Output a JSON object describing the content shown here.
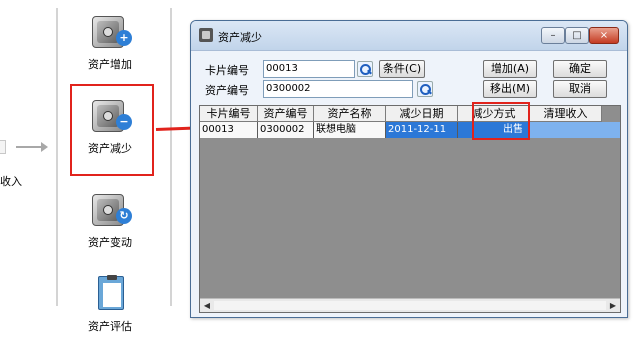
{
  "left_panel": {
    "edge_label": "收入",
    "items": [
      {
        "label": "资产增加",
        "icon": "safe-add-icon"
      },
      {
        "label": "资产减少",
        "icon": "safe-reduce-icon"
      },
      {
        "label": "资产变动",
        "icon": "safe-change-icon"
      },
      {
        "label": "资产评估",
        "icon": "clipboard-assess-icon"
      }
    ]
  },
  "window": {
    "title": "资产减少",
    "controls": {
      "minimize": "–",
      "maximize": "□",
      "close": "×"
    }
  },
  "form": {
    "card_label": "卡片编号",
    "card_value": "00013",
    "asset_label": "资产编号",
    "asset_value": "0300002",
    "condition_label": "条件(C)",
    "add_label": "增加(A)",
    "remove_label": "移出(M)",
    "ok_label": "确定",
    "cancel_label": "取消"
  },
  "table": {
    "columns": [
      "卡片编号",
      "资产编号",
      "资产名称",
      "减少日期",
      "减少方式",
      "清理收入"
    ],
    "rows": [
      {
        "card_no": "00013",
        "asset_no": "0300002",
        "name": "联想电脑",
        "date": "2011-12-11",
        "method": "出售",
        "income": ""
      }
    ]
  },
  "scroll": {
    "left": "◀",
    "right": "▶"
  },
  "colors": {
    "highlight": "#e1231c",
    "selection": "#2c78d7",
    "grid_bg": "#8e8e8e"
  }
}
